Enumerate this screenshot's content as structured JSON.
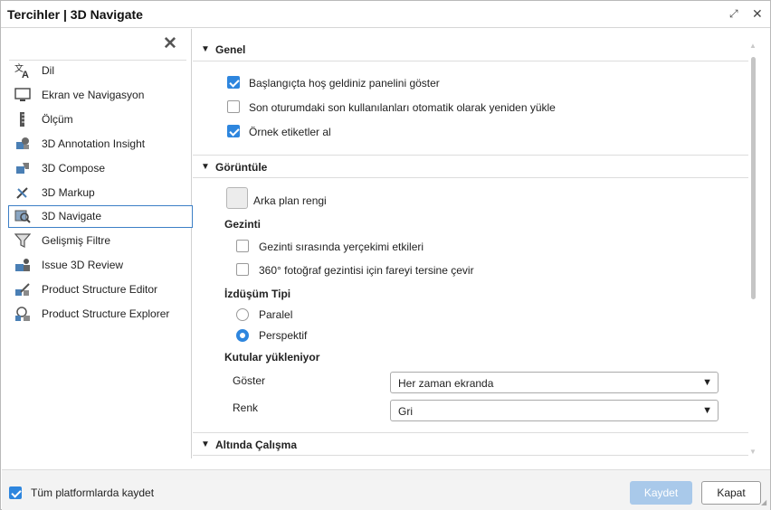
{
  "window": {
    "title": "Tercihler | 3D Navigate",
    "expand_glyph": "⤢",
    "close_glyph": "✕"
  },
  "sidebar": {
    "close_glyph": "✕",
    "items": [
      {
        "label": "Dil",
        "icon": "translate-icon"
      },
      {
        "label": "Ekran ve Navigasyon",
        "icon": "monitor-icon"
      },
      {
        "label": "Ölçüm",
        "icon": "ruler-icon"
      },
      {
        "label": "3D Annotation Insight",
        "icon": "annotation-icon"
      },
      {
        "label": "3D Compose",
        "icon": "compose-icon"
      },
      {
        "label": "3D Markup",
        "icon": "markup-icon"
      },
      {
        "label": "3D Navigate",
        "icon": "navigate-icon",
        "selected": true
      },
      {
        "label": "Gelişmiş Filtre",
        "icon": "filter-icon"
      },
      {
        "label": "Issue 3D Review",
        "icon": "review-icon"
      },
      {
        "label": "Product Structure Editor",
        "icon": "structure-editor-icon"
      },
      {
        "label": "Product Structure Explorer",
        "icon": "structure-explorer-icon"
      }
    ]
  },
  "sections": {
    "genel": {
      "title": "Genel",
      "options": [
        {
          "label": "Başlangıçta hoş geldiniz panelini göster",
          "checked": true
        },
        {
          "label": "Son oturumdaki son kullanılanları otomatik olarak yeniden yükle",
          "checked": false
        },
        {
          "label": "Örnek etiketler al",
          "checked": true
        }
      ]
    },
    "goruntule": {
      "title": "Görüntüle",
      "background_color_label": "Arka plan rengi",
      "gezinti": {
        "title": "Gezinti",
        "options": [
          {
            "label": "Gezinti sırasında yerçekimi etkileri",
            "checked": false
          },
          {
            "label": "360° fotoğraf gezintisi için fareyi tersine çevir",
            "checked": false
          }
        ]
      },
      "projection": {
        "title": "İzdüşüm Tipi",
        "options": [
          {
            "label": "Paralel",
            "selected": false
          },
          {
            "label": "Perspektif",
            "selected": true
          }
        ]
      },
      "loading_boxes": {
        "title": "Kutular yükleniyor",
        "show_label": "Göster",
        "show_value": "Her zaman ekranda",
        "color_label": "Renk",
        "color_value": "Gri"
      }
    },
    "altinda": {
      "title": "Altında Çalışma"
    }
  },
  "footer": {
    "save_all_platforms_label": "Tüm platformlarda kaydet",
    "save_all_platforms_checked": true,
    "save_button": "Kaydet",
    "close_button": "Kapat"
  },
  "colors": {
    "accent": "#2e86de",
    "selection_border": "#3c7fc6",
    "save_button_disabled": "#a9c9ea"
  }
}
